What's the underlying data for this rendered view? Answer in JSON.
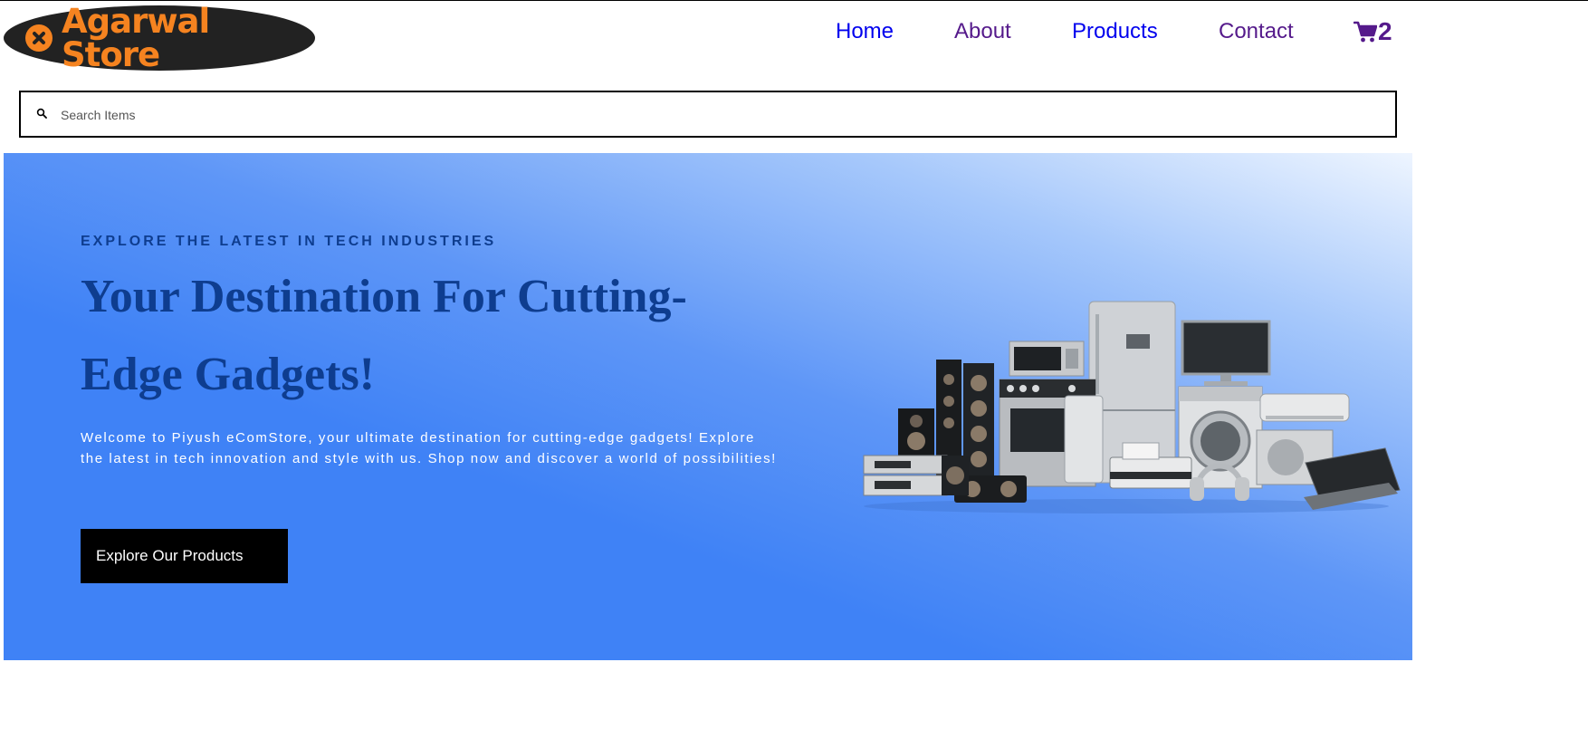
{
  "brand": {
    "name": "Agarwal Store",
    "logo_color": "#f58320",
    "logo_bg": "#222222"
  },
  "nav": {
    "items": [
      {
        "label": "Home",
        "color": "#0000ee"
      },
      {
        "label": "About",
        "color": "#551a8b"
      },
      {
        "label": "Products",
        "color": "#0000ee"
      },
      {
        "label": "Contact",
        "color": "#551a8b"
      }
    ],
    "cart": {
      "icon": "shopping-cart-icon",
      "count": "2",
      "color": "#551a8b"
    }
  },
  "search": {
    "icon": "search-icon",
    "placeholder": "Search Items",
    "value": ""
  },
  "hero": {
    "eyebrow": "EXPLORE THE LATEST IN TECH INDUSTRIES",
    "headline": "Your Destination For Cutting-Edge Gadgets!",
    "intro": "Welcome to Piyush eComStore, your ultimate destination for cutting-edge gadgets! Explore the latest in tech innovation and style with us. Shop now and discover a world of possibilities!",
    "cta_label": "Explore Our Products",
    "image": "electronics-appliances-image",
    "colors": {
      "heading": "#0e3d8f",
      "gradient_start": "#3f82f6",
      "gradient_end": "#eef5ff"
    }
  }
}
